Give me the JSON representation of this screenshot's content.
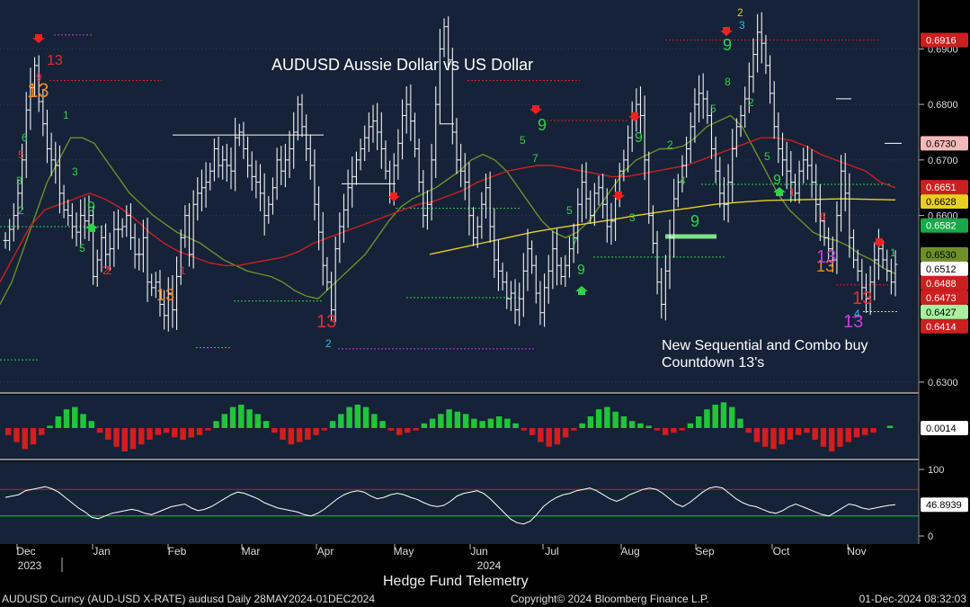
{
  "chart_data": {
    "type": "candlestick",
    "title": "AUDUSD Aussie Dollar vs US Dollar",
    "annotation": "New Sequential and Combo buy Countdown 13's",
    "x_labels": [
      "Dec",
      "Jan",
      "Feb",
      "Mar",
      "Apr",
      "May",
      "Jun",
      "Jul",
      "Aug",
      "Sep",
      "Oct",
      "Nov"
    ],
    "year_labels": [
      "2023",
      "2024"
    ],
    "price_axis": {
      "ticks": [
        "0.6900",
        "0.6800",
        "0.6700",
        "0.6600",
        "0.6300"
      ],
      "ylim": [
        0.6282,
        0.6988
      ]
    },
    "price_tags": [
      {
        "label": "0.6916",
        "color": "#cc1f1f",
        "text_color": "#ffffff",
        "value": 0.6916
      },
      {
        "label": "0.6730",
        "color": "#f4b8b8",
        "text_color": "#000000",
        "value": 0.673
      },
      {
        "label": "0.6651",
        "color": "#cc1f1f",
        "text_color": "#ffffff",
        "value": 0.6651
      },
      {
        "label": "0.6628",
        "color": "#e8d020",
        "text_color": "#000000",
        "value": 0.6628
      },
      {
        "label": "0.6582",
        "color": "#19a84a",
        "text_color": "#ffffff",
        "value": 0.6582
      },
      {
        "label": "0.6530",
        "color": "#6e8f2a",
        "text_color": "#000000",
        "value": 0.653
      },
      {
        "label": "0.6512",
        "color": "#ffffff",
        "text_color": "#000000",
        "value": 0.6512
      },
      {
        "label": "0.6488",
        "color": "#cc1f1f",
        "text_color": "#ffffff",
        "value": 0.6488
      },
      {
        "label": "0.6473",
        "color": "#cc1f1f",
        "text_color": "#ffffff",
        "value": 0.6473
      },
      {
        "label": "0.6427",
        "color": "#a8f0a0",
        "text_color": "#000000",
        "value": 0.6427
      },
      {
        "label": "0.6414",
        "color": "#cc1f1f",
        "text_color": "#ffffff",
        "value": 0.6414
      }
    ],
    "series": [
      {
        "name": "Close",
        "color": "#ffffff",
        "values": [
          0.6555,
          0.6575,
          0.66,
          0.664,
          0.67,
          0.679,
          0.683,
          0.687,
          0.6805,
          0.6765,
          0.672,
          0.67,
          0.669,
          0.664,
          0.661,
          0.66,
          0.658,
          0.657,
          0.66,
          0.659,
          0.66,
          0.649,
          0.652,
          0.656,
          0.653,
          0.654,
          0.6575,
          0.6575,
          0.658,
          0.66,
          0.656,
          0.653,
          0.653,
          0.656,
          0.648,
          0.647,
          0.648,
          0.644,
          0.642,
          0.646,
          0.643,
          0.649,
          0.656,
          0.66,
          0.653,
          0.662,
          0.664,
          0.665,
          0.666,
          0.668,
          0.672,
          0.669,
          0.67,
          0.669,
          0.668,
          0.674,
          0.675,
          0.672,
          0.669,
          0.667,
          0.666,
          0.664,
          0.66,
          0.662,
          0.665,
          0.67,
          0.668,
          0.67,
          0.672,
          0.675,
          0.68,
          0.676,
          0.672,
          0.669,
          0.662,
          0.657,
          0.651,
          0.648,
          0.643,
          0.654,
          0.658,
          0.661,
          0.665,
          0.667,
          0.67,
          0.672,
          0.674,
          0.676,
          0.677,
          0.675,
          0.672,
          0.668,
          0.664,
          0.669,
          0.673,
          0.678,
          0.68,
          0.677,
          0.672,
          0.666,
          0.66,
          0.662,
          0.67,
          0.68,
          0.69,
          0.694,
          0.688,
          0.675,
          0.67,
          0.668,
          0.666,
          0.66,
          0.656,
          0.658,
          0.662,
          0.665,
          0.658,
          0.652,
          0.65,
          0.648,
          0.645,
          0.646,
          0.643,
          0.645,
          0.65,
          0.654,
          0.651,
          0.646,
          0.6425,
          0.647,
          0.65,
          0.654,
          0.651,
          0.649,
          0.651,
          0.654,
          0.656,
          0.662,
          0.666,
          0.663,
          0.66,
          0.664,
          0.665,
          0.662,
          0.658,
          0.659,
          0.663,
          0.668,
          0.67,
          0.674,
          0.678,
          0.68,
          0.678,
          0.67,
          0.66,
          0.655,
          0.648,
          0.644,
          0.65,
          0.656,
          0.663,
          0.666,
          0.669,
          0.672,
          0.676,
          0.68,
          0.682,
          0.681,
          0.678,
          0.672,
          0.668,
          0.664,
          0.662,
          0.666,
          0.672,
          0.676,
          0.678,
          0.681,
          0.685,
          0.689,
          0.693,
          0.691,
          0.687,
          0.682,
          0.676,
          0.672,
          0.67,
          0.668,
          0.666,
          0.664,
          0.668,
          0.67,
          0.669,
          0.666,
          0.662,
          0.659,
          0.656,
          0.654,
          0.652,
          0.66,
          0.668,
          0.664,
          0.656,
          0.652,
          0.65,
          0.647,
          0.645,
          0.648,
          0.652,
          0.654,
          0.652,
          0.65,
          0.648,
          0.6512
        ]
      },
      {
        "name": "Olive MA",
        "color": "#6e8f2a",
        "values": [
          0.644,
          0.648,
          0.654,
          0.66,
          0.666,
          0.67,
          0.674,
          0.674,
          0.673,
          0.67,
          0.667,
          0.664,
          0.662,
          0.66,
          0.6585,
          0.657,
          0.656,
          0.655,
          0.6535,
          0.652,
          0.651,
          0.65,
          0.6495,
          0.649,
          0.648,
          0.6465,
          0.6455,
          0.645,
          0.647,
          0.649,
          0.651,
          0.653,
          0.656,
          0.659,
          0.6615,
          0.663,
          0.664,
          0.665,
          0.6665,
          0.668,
          0.67,
          0.671,
          0.67,
          0.668,
          0.665,
          0.662,
          0.659,
          0.657,
          0.656,
          0.657,
          0.659,
          0.662,
          0.665,
          0.668,
          0.67,
          0.671,
          0.672,
          0.672,
          0.6725,
          0.674,
          0.676,
          0.677,
          0.678,
          0.676,
          0.672,
          0.668,
          0.664,
          0.661,
          0.659,
          0.657,
          0.656,
          0.6555,
          0.6545,
          0.653,
          0.652,
          0.6505,
          0.6495
        ]
      },
      {
        "name": "Red MA",
        "color": "#cc2020",
        "values": [
          0.648,
          0.653,
          0.658,
          0.661,
          0.662,
          0.663,
          0.664,
          0.663,
          0.6615,
          0.6595,
          0.657,
          0.655,
          0.6535,
          0.6525,
          0.6515,
          0.651,
          0.651,
          0.6515,
          0.652,
          0.6525,
          0.6535,
          0.655,
          0.656,
          0.657,
          0.658,
          0.659,
          0.66,
          0.661,
          0.662,
          0.6625,
          0.6635,
          0.6645,
          0.666,
          0.667,
          0.668,
          0.6685,
          0.669,
          0.669,
          0.6685,
          0.668,
          0.6675,
          0.667,
          0.667,
          0.6675,
          0.668,
          0.6685,
          0.669,
          0.67,
          0.671,
          0.672,
          0.673,
          0.674,
          0.674,
          0.6735,
          0.6725,
          0.671,
          0.67,
          0.669,
          0.668,
          0.666,
          0.665
        ]
      },
      {
        "name": "Yellow MA",
        "color": "#e8d020",
        "values": [
          0.653,
          0.654,
          0.655,
          0.656,
          0.657,
          0.6578,
          0.6585,
          0.6592,
          0.66,
          0.6607,
          0.6613,
          0.662,
          0.6624,
          0.6627,
          0.6628,
          0.6629,
          0.663,
          0.6629,
          0.6628
        ]
      }
    ],
    "sequential_labels": [
      {
        "text": "13",
        "color": "#f28a1e"
      },
      {
        "text": "13",
        "color": "#e03030"
      },
      {
        "text": "9",
        "color": "#2fd24a"
      },
      {
        "text": "2",
        "color": "#e03030"
      },
      {
        "text": "13",
        "color": "#f28a1e"
      },
      {
        "text": "13",
        "color": "#e03030"
      },
      {
        "text": "9",
        "color": "#2fd24a"
      },
      {
        "text": "9",
        "color": "#2fd24a"
      },
      {
        "text": "9",
        "color": "#2fd24a"
      },
      {
        "text": "9",
        "color": "#2fd24a"
      },
      {
        "text": "9",
        "color": "#2fd24a"
      },
      {
        "text": "9",
        "color": "#2fd24a"
      },
      {
        "text": "13",
        "color": "#f28a1e"
      },
      {
        "text": "13",
        "color": "#c640d8"
      },
      {
        "text": "13",
        "color": "#e03030"
      },
      {
        "text": "13",
        "color": "#c640d8"
      }
    ],
    "histogram": {
      "value_label": "0.0014",
      "values": [
        -0.3,
        -0.6,
        -0.9,
        -0.7,
        -0.3,
        0.1,
        0.5,
        0.8,
        0.9,
        0.6,
        0.3,
        -0.2,
        -0.5,
        -0.8,
        -1.0,
        -0.9,
        -0.7,
        -0.5,
        -0.3,
        -0.2,
        -0.4,
        -0.5,
        -0.4,
        -0.3,
        -0.1,
        0.3,
        0.6,
        0.9,
        1.0,
        0.8,
        0.6,
        0.3,
        -0.2,
        -0.5,
        -0.7,
        -0.6,
        -0.5,
        -0.3,
        -0.1,
        0.3,
        0.6,
        0.9,
        1.0,
        0.9,
        0.6,
        0.3,
        -0.1,
        -0.3,
        -0.2,
        -0.1,
        0.2,
        0.4,
        0.6,
        0.8,
        0.7,
        0.6,
        0.4,
        0.3,
        0.4,
        0.5,
        0.4,
        0.2,
        -0.1,
        -0.3,
        -0.6,
        -0.8,
        -0.7,
        -0.4,
        -0.1,
        0.2,
        0.5,
        0.8,
        0.9,
        0.7,
        0.5,
        0.3,
        0.2,
        0.1,
        -0.1,
        -0.3,
        -0.2,
        -0.1,
        0.2,
        0.5,
        0.8,
        1.0,
        1.1,
        0.9,
        0.4,
        -0.2,
        -0.6,
        -0.8,
        -0.9,
        -0.7,
        -0.5,
        -0.3,
        -0.2,
        -0.5,
        -0.8,
        -1.0,
        -0.8,
        -0.6,
        -0.4,
        -0.3,
        -0.2,
        0.0,
        0.1
      ]
    },
    "oscillator": {
      "value_label": "46.8939",
      "ticks": [
        "100",
        "0"
      ],
      "ylim": [
        0,
        100
      ],
      "upper_line": 70,
      "lower_line": 30,
      "values": [
        58,
        60,
        62,
        68,
        70,
        72,
        74,
        71,
        66,
        58,
        50,
        42,
        36,
        28,
        26,
        30,
        34,
        36,
        38,
        40,
        38,
        34,
        32,
        36,
        40,
        44,
        46,
        48,
        42,
        38,
        40,
        44,
        50,
        56,
        62,
        66,
        64,
        60,
        56,
        50,
        46,
        42,
        40,
        38,
        36,
        32,
        30,
        34,
        40,
        48,
        56,
        62,
        66,
        68,
        66,
        60,
        56,
        58,
        62,
        64,
        62,
        58,
        55,
        50,
        46,
        44,
        46,
        52,
        60,
        64,
        66,
        68,
        64,
        56,
        46,
        36,
        26,
        20,
        18,
        22,
        32,
        44,
        52,
        58,
        62,
        64,
        68,
        70,
        72,
        68,
        62,
        56,
        52,
        56,
        62,
        66,
        70,
        72,
        70,
        64,
        56,
        48,
        44,
        50,
        58,
        66,
        72,
        74,
        72,
        64,
        56,
        50,
        46,
        44,
        40,
        36,
        34,
        38,
        44,
        48,
        44,
        40,
        36,
        32,
        30,
        36,
        42,
        48,
        46,
        42,
        40,
        42,
        44,
        46,
        47
      ]
    }
  },
  "labels": {
    "footer_security": "AUDUSD Curncy (AUD-USD X-RATE) audusd  Daily 28MAY2024-01DEC2024",
    "footer_copyright": "Copyright© 2024 Bloomberg Finance L.P.",
    "footer_timestamp": "01-Dec-2024 08:32:03",
    "source": "Hedge Fund Telemetry"
  }
}
